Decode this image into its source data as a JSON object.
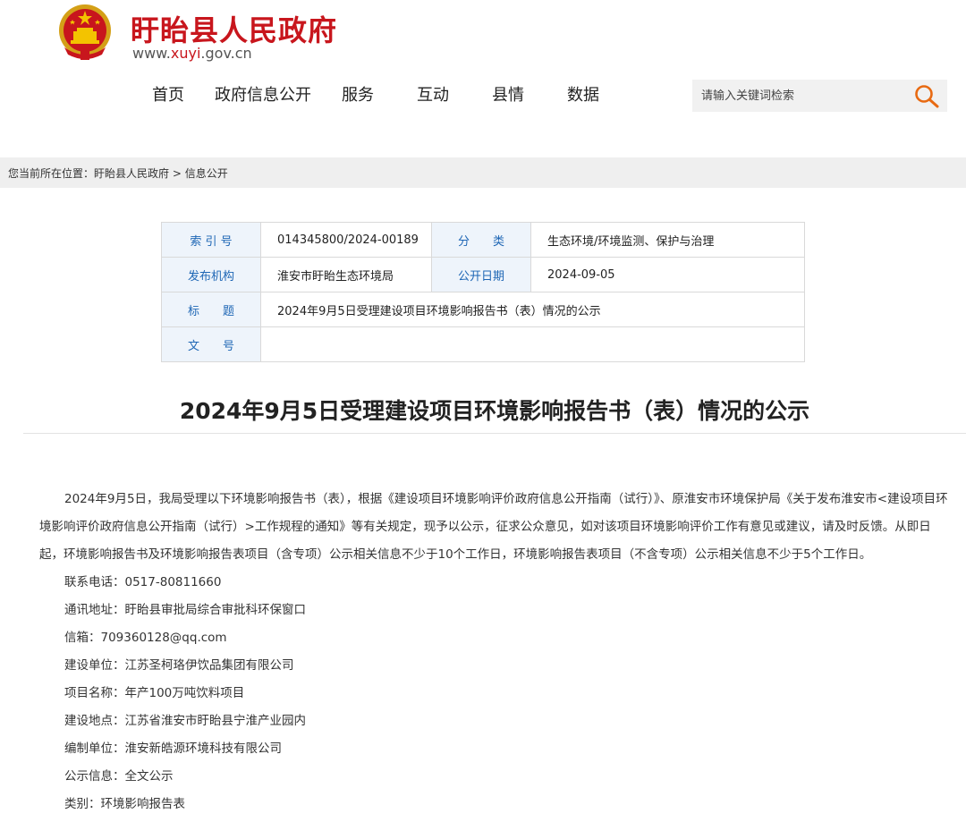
{
  "header": {
    "site_title": "盱眙县人民政府",
    "url_prefix": "www.",
    "url_highlight": "xuyi",
    "url_suffix": ".gov.cn",
    "brand_color": "#c8161d"
  },
  "nav": {
    "items": [
      "首页",
      "政府信息公开",
      "服务",
      "互动",
      "县情",
      "数据"
    ]
  },
  "search": {
    "placeholder": "请输入关键词检索",
    "icon": "search-icon"
  },
  "breadcrumb": {
    "prefix": "您当前所在位置：",
    "home": "盱眙县人民政府",
    "sep": " > ",
    "current": "信息公开"
  },
  "meta": {
    "index_label": "索 引 号",
    "index_value": "014345800/2024-00189",
    "category_label": "分　　类",
    "category_value": "生态环境/环境监测、保护与治理",
    "publisher_label": "发布机构",
    "publisher_value": "淮安市盱眙生态环境局",
    "date_label": "公开日期",
    "date_value": "2024-09-05",
    "title_label": "标　　题",
    "title_value": "2024年9月5日受理建设项目环境影响报告书（表）情况的公示",
    "docno_label": "文　　号",
    "docno_value": ""
  },
  "article": {
    "title": "2024年9月5日受理建设项目环境影响报告书（表）情况的公示",
    "intro": "2024年9月5日，我局受理以下环境影响报告书（表），根据《建设项目环境影响评价政府信息公开指南（试行）》、原淮安市环境保护局《关于发布淮安市<建设项目环境影响评价政府信息公开指南（试行）>工作规程的通知》等有关规定，现予以公示，征求公众意见，如对该项目环境影响评价工作有意见或建议，请及时反馈。从即日起，环境影响报告书及环境影响报告表项目（含专项）公示相关信息不少于10个工作日，环境影响报告表项目（不含专项）公示相关信息不少于5个工作日。",
    "lines": [
      "联系电话：0517-80811660",
      "通讯地址：盱眙县审批局综合审批科环保窗口",
      "信箱：709360128@qq.com",
      "建设单位：江苏圣柯珞伊饮品集团有限公司",
      "项目名称：年产100万吨饮料项目",
      "建设地点：江苏省淮安市盱眙县宁淮产业园内",
      "编制单位：淮安新皓源环境科技有限公司",
      "公示信息：全文公示",
      "类别：环境影响报告表"
    ]
  }
}
